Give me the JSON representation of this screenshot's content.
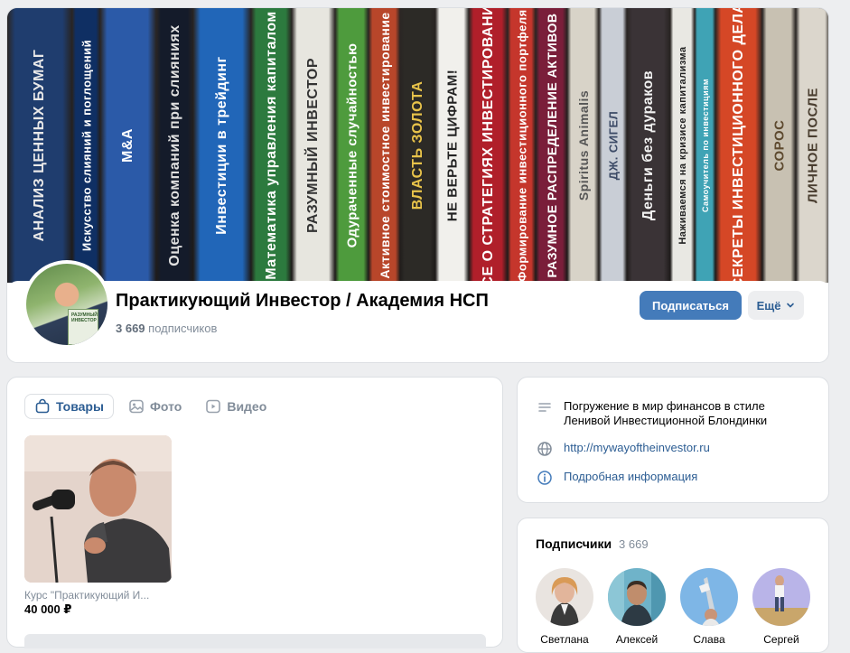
{
  "group": {
    "title": "Практикующий Инвестор / Академия НСП",
    "subscribers_count": "3 669",
    "subscribers_label": "подписчиков"
  },
  "cover_books": [
    {
      "text": "АНАЛИЗ ЦЕННЫХ БУМАГ",
      "color": "#1f3d6e",
      "fg": "#e8e8e8"
    },
    {
      "text": "Искусство слияний и поглощений",
      "color": "#0f2f63",
      "fg": "#ffffff"
    },
    {
      "text": "M&A",
      "color": "#2b5aa8",
      "fg": "#ffffff"
    },
    {
      "text": "Оценка компаний при слияниях",
      "color": "#141b2a",
      "fg": "#e0e0e0"
    },
    {
      "text": "Инвестиции в трейдинг",
      "color": "#2166b8",
      "fg": "#ffffff"
    },
    {
      "text": "Математика управления капиталом",
      "color": "#2c7a3e",
      "fg": "#ffffff"
    },
    {
      "text": "РАЗУМНЫЙ ИНВЕСТОР",
      "color": "#e7e6df",
      "fg": "#333333"
    },
    {
      "text": "Одураченные случайностью",
      "color": "#4e9b3d",
      "fg": "#ffffff"
    },
    {
      "text": "Активное стоимостное инвестирование",
      "color": "#b8462a",
      "fg": "#ffffff"
    },
    {
      "text": "ВЛАСТЬ ЗОЛОТА",
      "color": "#2c2a26",
      "fg": "#e8c34a"
    },
    {
      "text": "НЕ ВЕРЬТЕ ЦИФРАМ!",
      "color": "#f1f0ec",
      "fg": "#222222"
    },
    {
      "text": "ВСЕ О СТРАТЕГИЯХ ИНВЕСТИРОВАНИЯ",
      "color": "#b01f2a",
      "fg": "#ffffff"
    },
    {
      "text": "Формирование инвестиционного портфеля",
      "color": "#c5362c",
      "fg": "#ffffff"
    },
    {
      "text": "РАЗУМНОЕ РАСПРЕДЕЛЕНИЕ АКТИВОВ",
      "color": "#7a1e3a",
      "fg": "#ffffff"
    },
    {
      "text": "Spiritus Animalis",
      "color": "#d8d3c8",
      "fg": "#555555"
    },
    {
      "text": "ДЖ. СИГЕЛ",
      "color": "#c9ced6",
      "fg": "#3c4a66"
    },
    {
      "text": "Деньги без дураков",
      "color": "#3a3336",
      "fg": "#f2f2f2"
    },
    {
      "text": "Наживаемся на кризисе капитализма",
      "color": "#e9e8e3",
      "fg": "#222222"
    },
    {
      "text": "Самоучитель по инвестициям",
      "color": "#3fa3b5",
      "fg": "#ffffff"
    },
    {
      "text": "СЕКРЕТЫ ИНВЕСТИЦИОННОГО ДЕЛА",
      "color": "#d54726",
      "fg": "#ffffff"
    },
    {
      "text": "СОРОС",
      "color": "#c8c1b2",
      "fg": "#5e4a2f"
    },
    {
      "text": "ЛИЧНОЕ ПОСЛЕ",
      "color": "#dbd6cc",
      "fg": "#4a3e30"
    }
  ],
  "buttons": {
    "subscribe": "Подписаться",
    "more": "Ещё"
  },
  "tabs": [
    {
      "label": "Товары",
      "icon": "bag-icon",
      "active": true
    },
    {
      "label": "Фото",
      "icon": "photo-icon",
      "active": false
    },
    {
      "label": "Видео",
      "icon": "video-icon",
      "active": false
    }
  ],
  "product": {
    "name": "Курс \"Практикующий И...",
    "price": "40 000 ₽"
  },
  "info": {
    "description": "Погружение в мир финансов в стиле Ленивой Инвестиционной Блондинки",
    "website": "http://mywayoftheinvestor.ru",
    "details": "Подробная информация"
  },
  "subscribers_block": {
    "title": "Подписчики",
    "count": "3 669",
    "members": [
      {
        "name": "Светлана"
      },
      {
        "name": "Алексей"
      },
      {
        "name": "Слава"
      },
      {
        "name": "Сергей"
      }
    ]
  },
  "colors": {
    "accent": "#447bba",
    "link": "#2c5d93",
    "secondary_text": "#818c99",
    "background": "#edeef0"
  }
}
